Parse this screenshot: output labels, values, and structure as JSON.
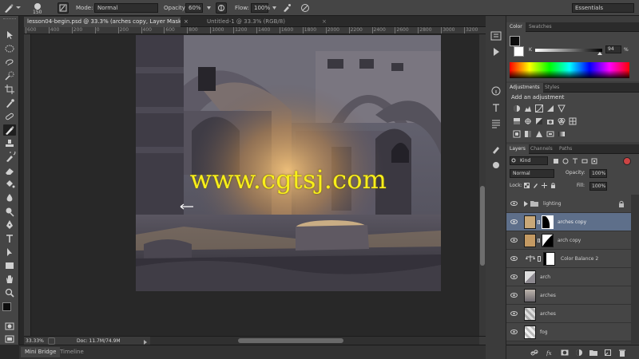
{
  "options_bar": {
    "brush_size": "150",
    "mode_label": "Mode:",
    "mode_value": "Normal",
    "opacity_label": "Opacity:",
    "opacity_value": "60%",
    "flow_label": "Flow:",
    "flow_value": "100%",
    "workspace": "Essentials"
  },
  "document_tabs": [
    {
      "label": "lesson04-begin.psd @ 33.3% (arches copy, Layer Mask/8) *",
      "active": true
    },
    {
      "label": "Untitled-1 @ 33.3% (RGB/8)",
      "active": false
    }
  ],
  "ruler_ticks": [
    "600",
    "400",
    "200",
    "0",
    "200",
    "400",
    "600",
    "800",
    "1000",
    "1200",
    "1400",
    "1600",
    "1800",
    "2000",
    "2200",
    "2400",
    "2600",
    "2800",
    "3000",
    "3200"
  ],
  "canvas": {
    "watermark": "www.cgtsj.com"
  },
  "status_bar": {
    "zoom": "33.33%",
    "doc_info": "Doc: 11.7M/74.9M"
  },
  "bottom_tabs": [
    {
      "label": "Mini Bridge",
      "active": true
    },
    {
      "label": "Timeline",
      "active": false
    }
  ],
  "color_panel": {
    "tabs": [
      "Color",
      "Swatches"
    ],
    "channel": "K",
    "value": "94",
    "unit": "%",
    "foreground": "#0d0d0d",
    "background": "#ffffff"
  },
  "adjustments_panel": {
    "tabs": [
      "Adjustments",
      "Styles"
    ],
    "heading": "Add an adjustment"
  },
  "layers_panel": {
    "tabs": [
      "Layers",
      "Channels",
      "Paths"
    ],
    "kind_filter": "Kind",
    "blend_mode": "Normal",
    "opacity_label": "Opacity:",
    "opacity_value": "100%",
    "lock_label": "Lock:",
    "fill_label": "Fill:",
    "fill_value": "100%",
    "layers": [
      {
        "name": "lighting",
        "type": "group",
        "selected": false
      },
      {
        "name": "arches copy",
        "type": "masked",
        "selected": true
      },
      {
        "name": "arch copy",
        "type": "masked",
        "selected": false
      },
      {
        "name": "Color Balance 2",
        "type": "adjustment",
        "selected": false
      },
      {
        "name": "arch",
        "type": "pixel",
        "selected": false
      },
      {
        "name": "arches",
        "type": "pixel",
        "selected": false
      },
      {
        "name": "arches",
        "type": "pixel",
        "selected": false
      },
      {
        "name": "fog",
        "type": "pixel",
        "selected": false
      }
    ]
  },
  "colors": {
    "panel_bg": "#454545",
    "app_bg": "#282828",
    "selection": "#5e6f8a",
    "watermark": "#f8ef1a"
  }
}
